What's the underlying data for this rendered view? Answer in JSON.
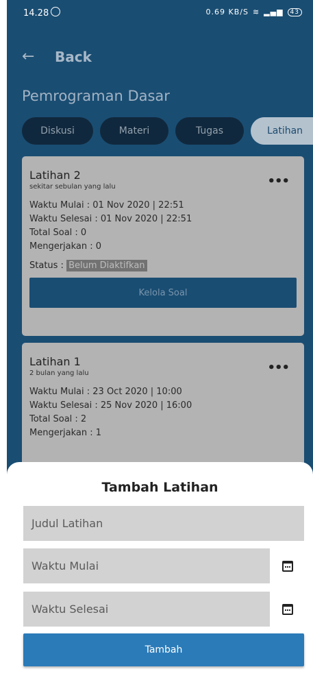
{
  "status_bar": {
    "time": "14.28",
    "speed": "0.69 KB/S",
    "battery": "43"
  },
  "header": {
    "back_label": "Back",
    "course_title": "Pemrograman Dasar"
  },
  "tabs": [
    {
      "label": "Diskusi",
      "active": false
    },
    {
      "label": "Materi",
      "active": false
    },
    {
      "label": "Tugas",
      "active": false
    },
    {
      "label": "Latihan",
      "active": true
    }
  ],
  "cards": [
    {
      "title": "Latihan 2",
      "time_ago": "sekitar sebulan yang lalu",
      "lines": [
        "Waktu Mulai : 01 Nov 2020 | 22:51",
        "Waktu Selesai : 01 Nov 2020 | 22:51",
        "Total Soal : 0",
        "Mengerjakan : 0"
      ],
      "status_label": "Status :",
      "status_value": "Belum Diaktifkan",
      "button_label": "Kelola Soal"
    },
    {
      "title": "Latihan 1",
      "time_ago": "2 bulan yang lalu",
      "lines": [
        "Waktu Mulai : 23 Oct 2020 | 10:00",
        "Waktu Selesai : 25 Nov 2020 | 16:00",
        "Total Soal : 2",
        "Mengerjakan : 1"
      ]
    }
  ],
  "sheet": {
    "title": "Tambah Latihan",
    "title_placeholder": "Judul Latihan",
    "start_placeholder": "Waktu Mulai",
    "end_placeholder": "Waktu Selesai",
    "submit_label": "Tambah"
  },
  "icons": {
    "back": "arrow-left-icon",
    "menu": "more-horizontal-icon",
    "calendar": "calendar-icon"
  },
  "colors": {
    "background": "#1a4d72",
    "accent": "#2b7bb9",
    "card": "#b3b3b3",
    "tab": "#10283d"
  }
}
